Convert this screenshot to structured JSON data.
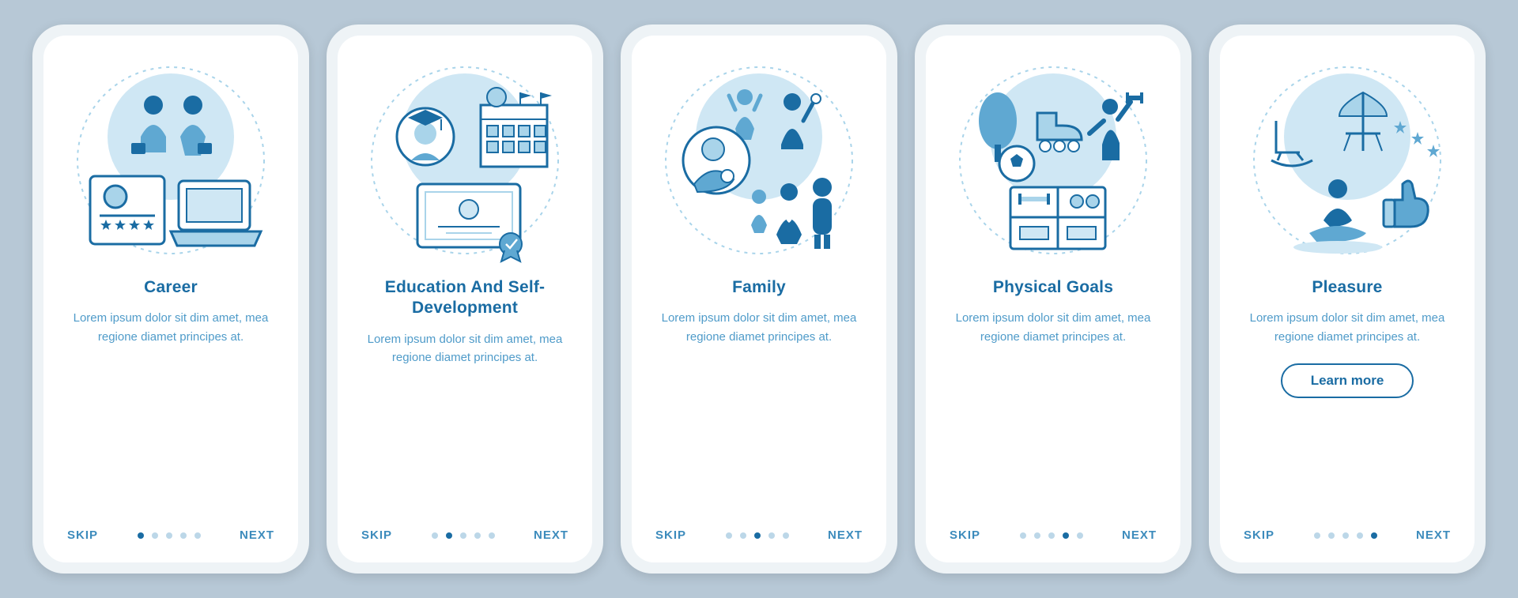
{
  "colors": {
    "background": "#b7c8d6",
    "phoneFrame": "#eef3f6",
    "screen": "#ffffff",
    "titleColor": "#1a6ca3",
    "textColor": "#4f9bc9",
    "dotInactive": "#bcd7e8",
    "dotActive": "#1a6ca3",
    "illusLight": "#a9d4ea",
    "illusMid": "#5fa8d2",
    "illusDark": "#1a6ca3"
  },
  "common": {
    "skip": "SKIP",
    "next": "NEXT",
    "learnMore": "Learn more",
    "totalDots": 5
  },
  "screens": [
    {
      "id": "career",
      "title": "Career",
      "description": "Lorem ipsum dolor sit dim amet, mea regione diamet principes at.",
      "activeDot": 0,
      "hasLearnMore": false,
      "icon": "career-icon"
    },
    {
      "id": "education",
      "title": "Education And Self-Development",
      "description": "Lorem ipsum dolor sit dim amet, mea regione diamet principes at.",
      "activeDot": 1,
      "hasLearnMore": false,
      "icon": "education-icon"
    },
    {
      "id": "family",
      "title": "Family",
      "description": "Lorem ipsum dolor sit dim amet, mea regione diamet principes at.",
      "activeDot": 2,
      "hasLearnMore": false,
      "icon": "family-icon"
    },
    {
      "id": "physical",
      "title": "Physical Goals",
      "description": "Lorem ipsum dolor sit dim amet, mea regione diamet principes at.",
      "activeDot": 3,
      "hasLearnMore": false,
      "icon": "physical-icon"
    },
    {
      "id": "pleasure",
      "title": "Pleasure",
      "description": "Lorem ipsum dolor sit dim amet, mea regione diamet principes at.",
      "activeDot": 4,
      "hasLearnMore": true,
      "icon": "pleasure-icon"
    }
  ]
}
